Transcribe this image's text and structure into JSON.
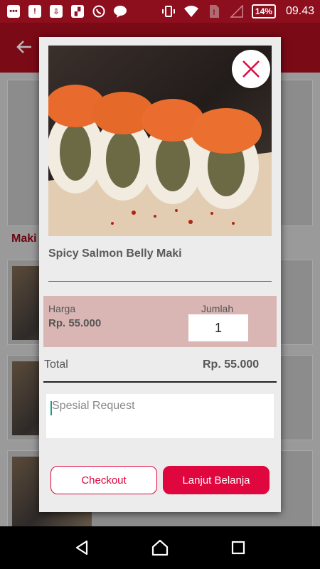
{
  "status_bar": {
    "time": "09.43",
    "battery": "14%",
    "left_icons": [
      "chat-bubble-icon",
      "alert-icon",
      "download-icon",
      "flipboard-icon",
      "whatsapp-icon",
      "line-icon"
    ],
    "right_icons": [
      "vibrate-icon",
      "wifi-icon",
      "sim-alert-icon",
      "signal-icon"
    ]
  },
  "background": {
    "section_label": "Maki"
  },
  "dialog": {
    "product_name": "Spicy Salmon Belly Maki",
    "price_label": "Harga",
    "price_value": "Rp. 55.000",
    "qty_label": "Jumlah",
    "qty_value": "1",
    "total_label": "Total",
    "total_value": "Rp. 55.000",
    "request_placeholder": "Spesial Request",
    "checkout_label": "Checkout",
    "continue_label": "Lanjut Belanja"
  },
  "colors": {
    "accent": "#e0063e",
    "status_bar": "#8d0e1d",
    "price_band": "#d9b6b4"
  }
}
